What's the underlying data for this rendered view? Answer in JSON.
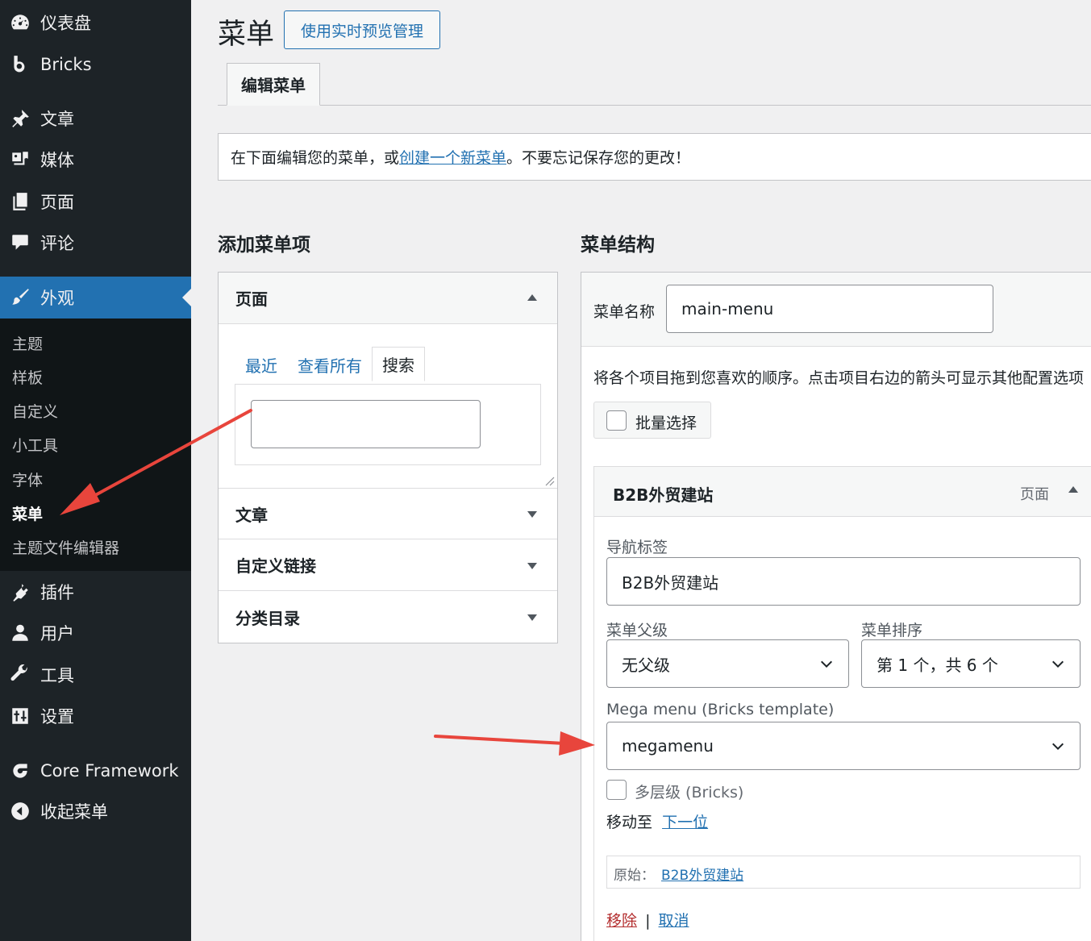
{
  "sidebar": {
    "top_items": [
      {
        "label": "仪表盘",
        "icon": "dashboard-icon"
      },
      {
        "label": "Bricks",
        "icon": "bricks-icon"
      },
      {
        "label": "文章",
        "icon": "pin-icon"
      },
      {
        "label": "媒体",
        "icon": "media-icon"
      },
      {
        "label": "页面",
        "icon": "page-icon"
      },
      {
        "label": "评论",
        "icon": "comment-icon"
      },
      {
        "label": "外观",
        "icon": "brush-icon"
      }
    ],
    "submenu": [
      {
        "label": "主题"
      },
      {
        "label": "样板"
      },
      {
        "label": "自定义"
      },
      {
        "label": "小工具"
      },
      {
        "label": "字体"
      },
      {
        "label": "菜单"
      },
      {
        "label": "主题文件编辑器"
      }
    ],
    "bottom_items": [
      {
        "label": "插件",
        "icon": "plugin-icon"
      },
      {
        "label": "用户",
        "icon": "user-icon"
      },
      {
        "label": "工具",
        "icon": "wrench-icon"
      },
      {
        "label": "设置",
        "icon": "settings-icon"
      },
      {
        "label": "Core Framework",
        "icon": "core-framework-icon"
      },
      {
        "label": "收起菜单",
        "icon": "collapse-icon"
      }
    ]
  },
  "header": {
    "title": "菜单",
    "live_preview_button": "使用实时预览管理",
    "tab_edit": "编辑菜单"
  },
  "notice": {
    "prefix": "在下面编辑您的菜单，或",
    "link": "创建一个新菜单",
    "suffix": "。不要忘记保存您的更改！"
  },
  "add_items": {
    "title": "添加菜单项",
    "pages_section": "页面",
    "tab_recent": "最近",
    "tab_all": "查看所有",
    "tab_search": "搜索",
    "search_value": "",
    "sections": [
      "文章",
      "自定义链接",
      "分类目录"
    ]
  },
  "structure": {
    "title": "菜单结构",
    "menu_name_label": "菜单名称",
    "menu_name_value": "main-menu",
    "instructions": "将各个项目拖到您喜欢的顺序。点击项目右边的箭头可显示其他配置选项",
    "bulk_select": "批量选择",
    "item": {
      "title": "B2B外贸建站",
      "type": "页面",
      "nav_label_label": "导航标签",
      "nav_label_value": "B2B外贸建站",
      "parent_label": "菜单父级",
      "parent_value": "无父级",
      "order_label": "菜单排序",
      "order_value": "第 1 个，共 6 个",
      "mega_label": "Mega menu (Bricks template)",
      "mega_value": "megamenu",
      "multilevel_label": "多层级 (Bricks)",
      "move_label": "移动至",
      "move_link": "下一位",
      "original_label": "原始：",
      "original_link": "B2B外贸建站",
      "remove": "移除",
      "separator": "|",
      "cancel": "取消"
    }
  },
  "colors": {
    "sidebar_bg": "#1d2327",
    "submenu_bg": "#101517",
    "accent": "#2271b1",
    "annotation_arrow": "#e8453c",
    "danger": "#b32d2e"
  }
}
